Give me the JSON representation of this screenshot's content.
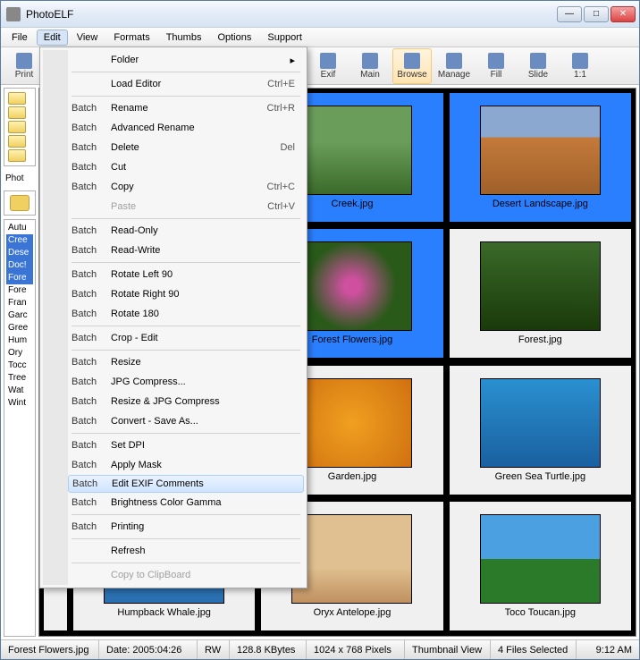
{
  "window": {
    "title": "PhotoELF"
  },
  "menubar": [
    "File",
    "Edit",
    "View",
    "Formats",
    "Thumbs",
    "Options",
    "Support"
  ],
  "menubar_open_index": 1,
  "toolbar": {
    "left": [
      {
        "label": "Print"
      }
    ],
    "right": [
      {
        "label": "Exif"
      },
      {
        "label": "Main"
      },
      {
        "label": "Browse",
        "active": true
      },
      {
        "label": "Manage"
      },
      {
        "label": "Fill"
      },
      {
        "label": "Slide"
      },
      {
        "label": "1:1"
      }
    ]
  },
  "edit_menu": [
    {
      "type": "item",
      "c2": "Folder",
      "arrow": true
    },
    {
      "type": "sep"
    },
    {
      "type": "item",
      "c2": "Load Editor",
      "c3": "Ctrl+E"
    },
    {
      "type": "sep"
    },
    {
      "type": "item",
      "c1": "Batch",
      "c2": "Rename",
      "c3": "Ctrl+R"
    },
    {
      "type": "item",
      "c1": "Batch",
      "c2": "Advanced Rename"
    },
    {
      "type": "item",
      "c1": "Batch",
      "c2": "Delete",
      "c3": "Del"
    },
    {
      "type": "item",
      "c1": "Batch",
      "c2": "Cut"
    },
    {
      "type": "item",
      "c1": "Batch",
      "c2": "Copy",
      "c3": "Ctrl+C"
    },
    {
      "type": "item",
      "c2": "Paste",
      "c3": "Ctrl+V",
      "disabled": true
    },
    {
      "type": "sep"
    },
    {
      "type": "item",
      "c1": "Batch",
      "c2": "Read-Only"
    },
    {
      "type": "item",
      "c1": "Batch",
      "c2": "Read-Write"
    },
    {
      "type": "sep"
    },
    {
      "type": "item",
      "c1": "Batch",
      "c2": "Rotate Left 90"
    },
    {
      "type": "item",
      "c1": "Batch",
      "c2": "Rotate Right 90"
    },
    {
      "type": "item",
      "c1": "Batch",
      "c2": "Rotate 180"
    },
    {
      "type": "sep"
    },
    {
      "type": "item",
      "c1": "Batch",
      "c2": "Crop - Edit"
    },
    {
      "type": "sep"
    },
    {
      "type": "item",
      "c1": "Batch",
      "c2": "Resize"
    },
    {
      "type": "item",
      "c1": "Batch",
      "c2": "JPG Compress..."
    },
    {
      "type": "item",
      "c1": "Batch",
      "c2": "Resize & JPG Compress"
    },
    {
      "type": "item",
      "c1": "Batch",
      "c2": "Convert - Save As..."
    },
    {
      "type": "sep"
    },
    {
      "type": "item",
      "c1": "Batch",
      "c2": "Set DPI"
    },
    {
      "type": "item",
      "c1": "Batch",
      "c2": "Apply Mask"
    },
    {
      "type": "item",
      "c1": "Batch",
      "c2": "Edit EXIF Comments",
      "highlight": true
    },
    {
      "type": "item",
      "c1": "Batch",
      "c2": "Brightness Color Gamma"
    },
    {
      "type": "sep"
    },
    {
      "type": "item",
      "c1": "Batch",
      "c2": "Printing"
    },
    {
      "type": "sep"
    },
    {
      "type": "item",
      "c2": "Refresh"
    },
    {
      "type": "sep"
    },
    {
      "type": "item",
      "c2": "Copy to ClipBoard",
      "disabled": true
    }
  ],
  "left_panel": {
    "label": "Phot",
    "file_list": [
      {
        "t": "Autu"
      },
      {
        "t": "Cree",
        "sel": true
      },
      {
        "t": "Dese",
        "sel": true
      },
      {
        "t": "Doc!",
        "sel": true
      },
      {
        "t": "Fore",
        "sel": true
      },
      {
        "t": "Fore"
      },
      {
        "t": "Fran"
      },
      {
        "t": "Garc"
      },
      {
        "t": "Gree"
      },
      {
        "t": "Hum"
      },
      {
        "t": "Ory"
      },
      {
        "t": "Tocc"
      },
      {
        "t": "Tree"
      },
      {
        "t": "Wat"
      },
      {
        "t": "Wint"
      }
    ]
  },
  "thumbnails": [
    {
      "caption": "",
      "cls": "creek",
      "hidden": true
    },
    {
      "caption": "Creek.jpg",
      "cls": "creek",
      "sel": true
    },
    {
      "caption": "Desert Landscape.jpg",
      "cls": "desert",
      "sel": true
    },
    {
      "caption": "",
      "cls": "flowers",
      "hidden": true
    },
    {
      "caption": "Forest Flowers.jpg",
      "cls": "flowers",
      "sel": true
    },
    {
      "caption": "Forest.jpg",
      "cls": "forest"
    },
    {
      "caption": "",
      "cls": "garden",
      "hidden": true
    },
    {
      "caption": "Garden.jpg",
      "cls": "garden"
    },
    {
      "caption": "Green Sea Turtle.jpg",
      "cls": "turtle"
    },
    {
      "caption": "Humpback Whale.jpg",
      "cls": "whale",
      "hidden": true
    },
    {
      "caption": "Oryx Antelope.jpg",
      "cls": "oryx"
    },
    {
      "caption": "Toco Toucan.jpg",
      "cls": "toucan"
    }
  ],
  "statusbar": {
    "filename": "Forest Flowers.jpg",
    "date_label": "Date:",
    "date": "2005:04:26",
    "rw": "RW",
    "size": "128.8 KBytes",
    "dims": "1024 x 768 Pixels",
    "view": "Thumbnail View",
    "selected": "4 Files Selected",
    "time": "9:12 AM"
  }
}
